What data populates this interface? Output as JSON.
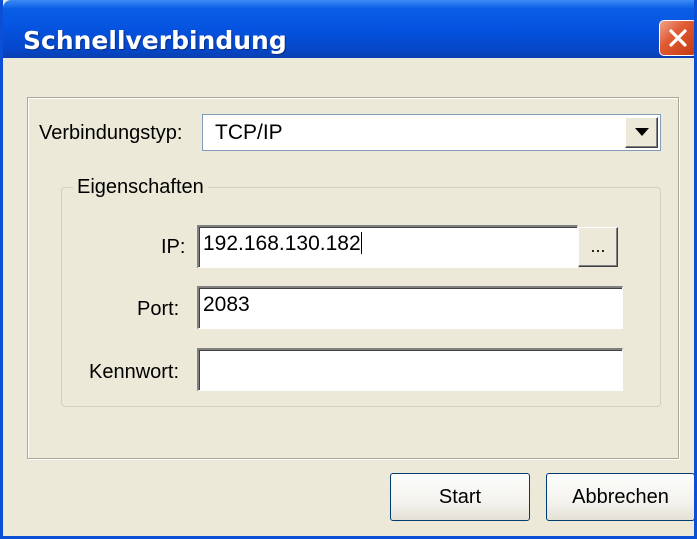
{
  "window": {
    "title": "Schnellverbindung"
  },
  "titlebar": {
    "close_icon": "close-icon"
  },
  "connection": {
    "type_label": "Verbindungstyp:",
    "type_value": "TCP/IP",
    "dropdown_icon": "chevron-down-icon"
  },
  "properties": {
    "legend": "Eigenschaften",
    "ip_label": "IP:",
    "ip_value": "192.168.130.182",
    "browse_label": "...",
    "port_label": "Port:",
    "port_value": "2083",
    "password_label": "Kennwort:",
    "password_value": ""
  },
  "buttons": {
    "start_label": "Start",
    "cancel_label": "Abbrechen"
  },
  "colors": {
    "titlebar": "#0553e0",
    "close_button": "#e05a32",
    "dialog_background": "#ece9d8"
  }
}
